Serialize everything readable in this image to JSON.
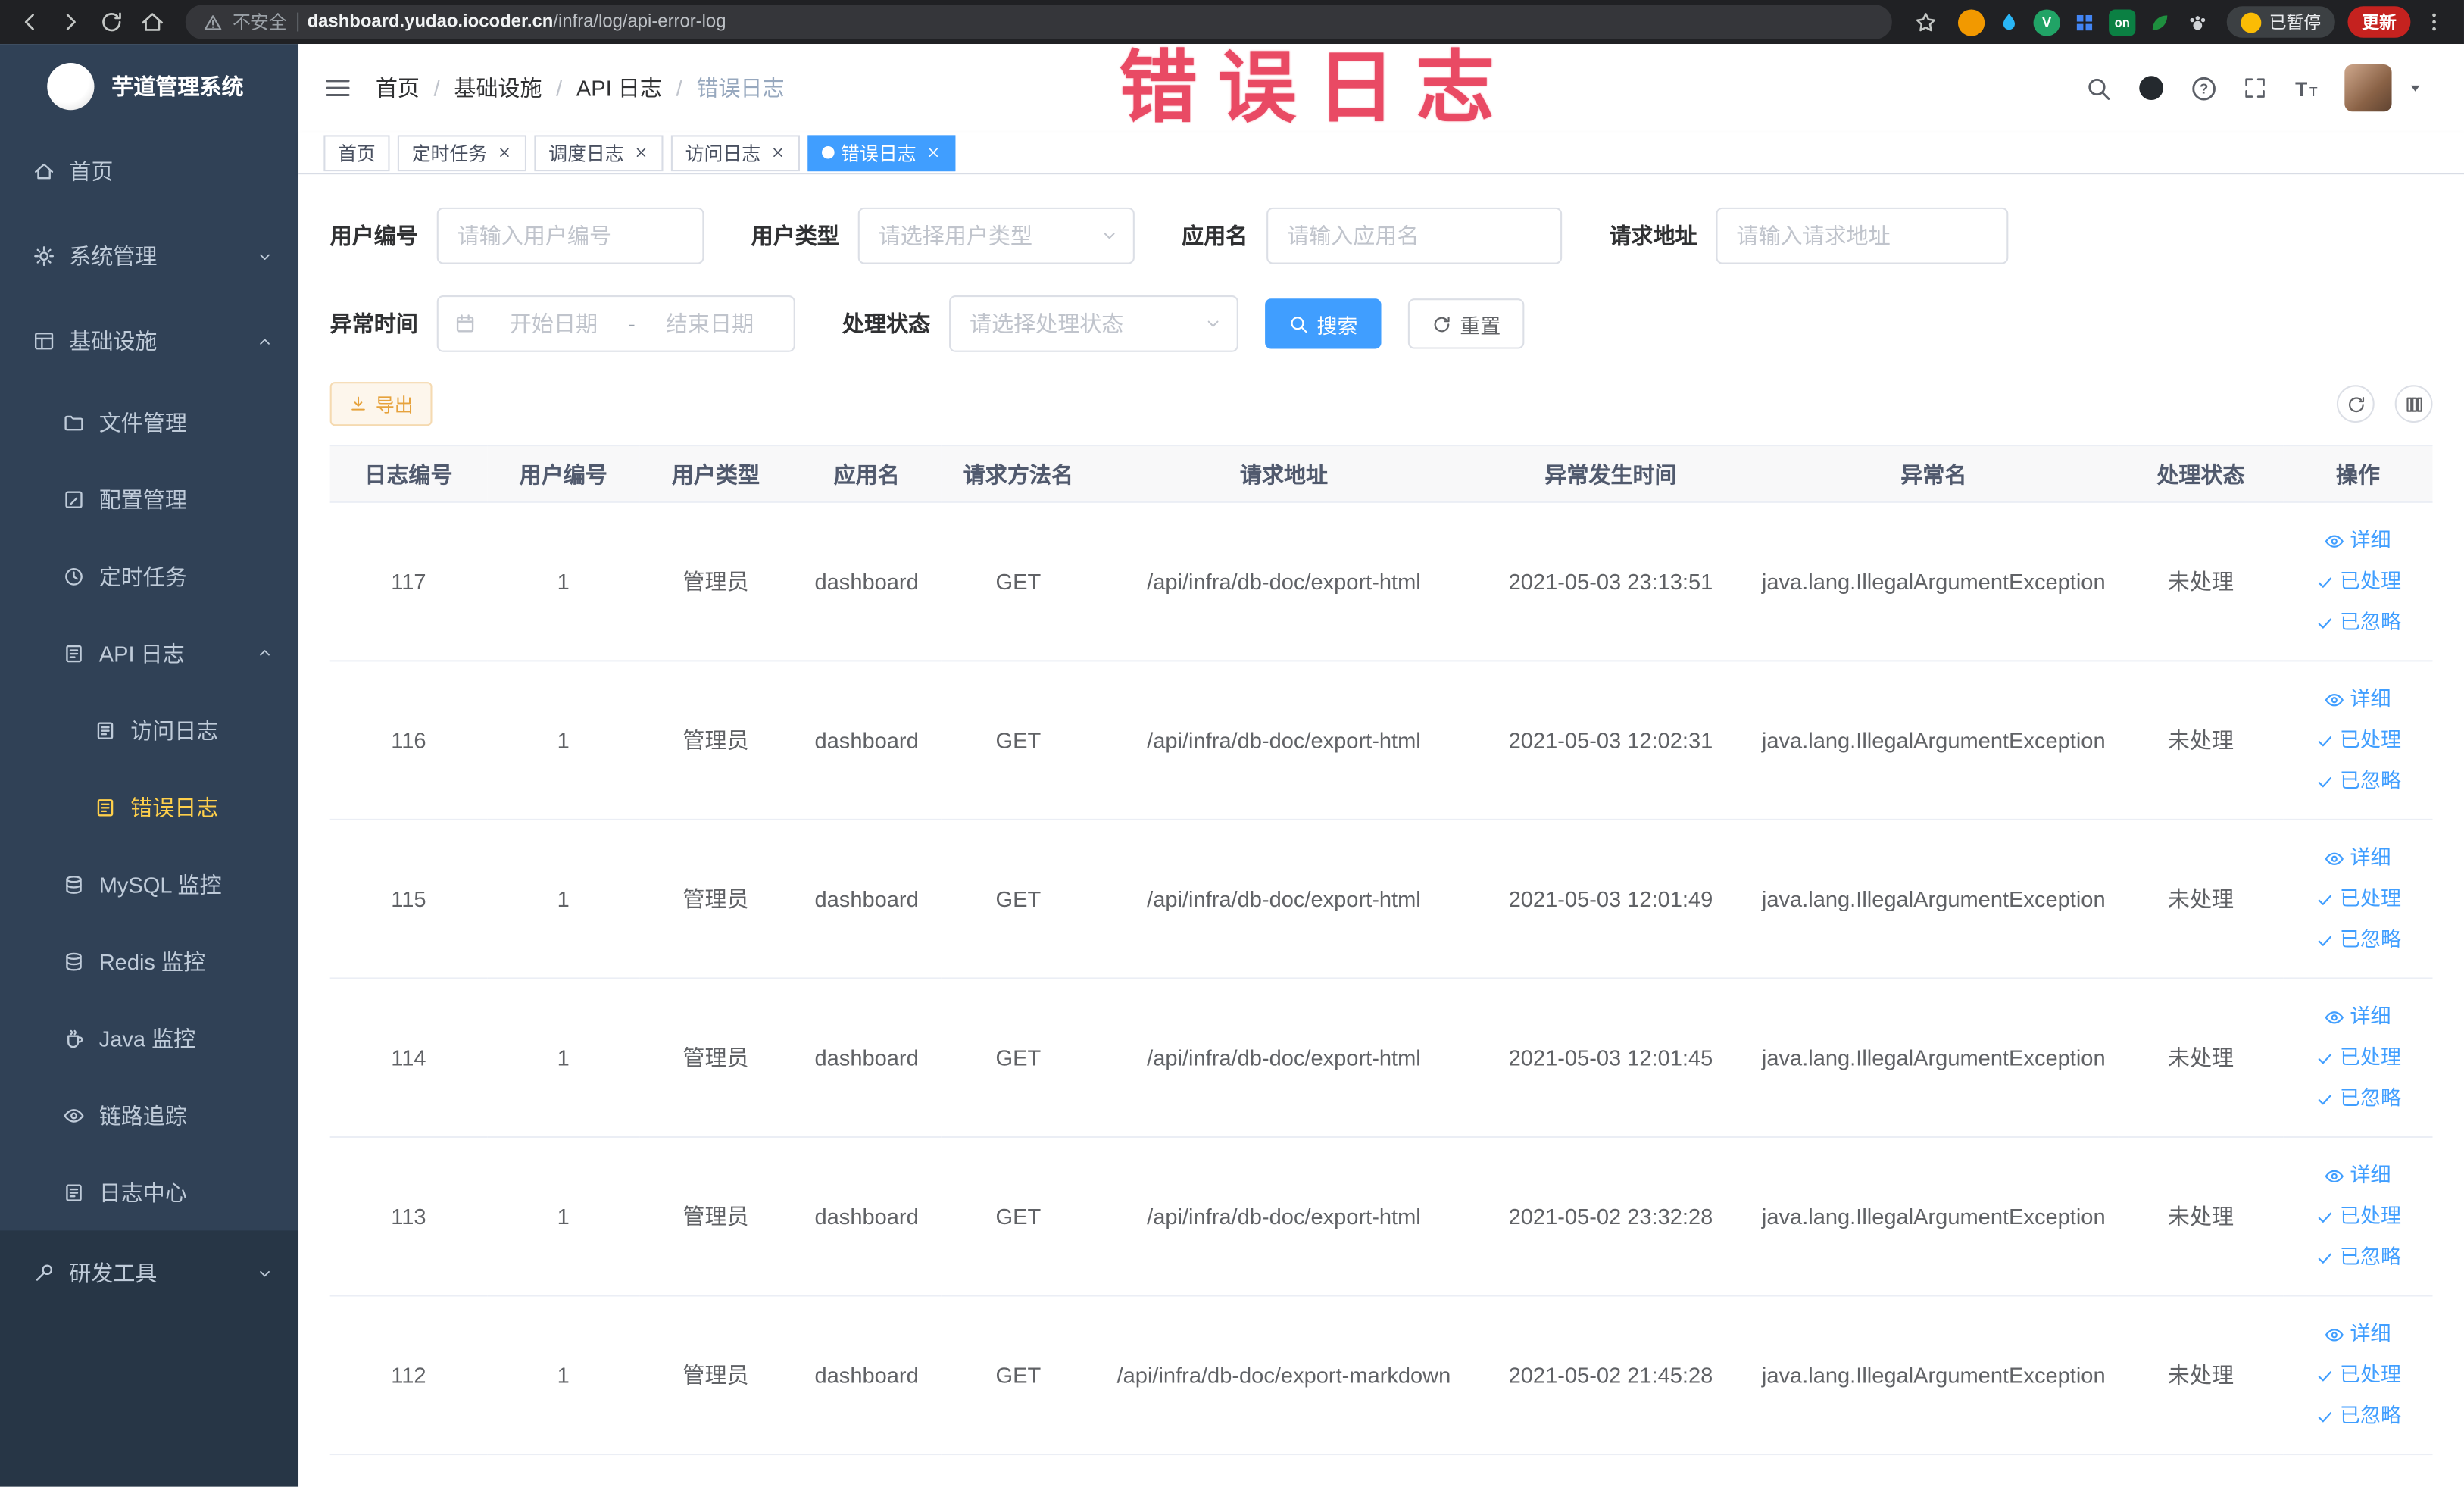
{
  "annotation": {
    "overlay_text": "错误日志"
  },
  "browser": {
    "security_label": "不安全",
    "url_domain": "dashboard.yudao.iocoder.cn",
    "url_path": "/infra/log/api-error-log",
    "paused_chip": "已暂停",
    "update_button": "更新",
    "extensions": [
      {
        "name": "orange-circle",
        "shape": "circle",
        "color": "#f29900"
      },
      {
        "name": "water-drop",
        "icon": "drop",
        "color": "#29b6f6"
      },
      {
        "name": "green-v",
        "shape": "circle",
        "color": "#21a366",
        "label": "V"
      },
      {
        "name": "blue-grid",
        "icon": "gridext",
        "color": "#4285f4"
      },
      {
        "name": "on-badge",
        "shape": "square",
        "color": "#0b8043",
        "label": "on"
      },
      {
        "name": "leaf",
        "icon": "leaf",
        "color": "#1e8e3e"
      },
      {
        "name": "paw",
        "icon": "paw",
        "color": "#cfd2d6"
      }
    ]
  },
  "sidebar": {
    "logo_title": "芋道管理系统",
    "items": [
      {
        "key": "home",
        "label": "首页",
        "icon": "home",
        "level": 1
      },
      {
        "key": "system",
        "label": "系统管理",
        "icon": "gear",
        "level": 1,
        "arrow": "down"
      },
      {
        "key": "infra",
        "label": "基础设施",
        "icon": "grid",
        "level": 1,
        "arrow": "up"
      },
      {
        "key": "file",
        "label": "文件管理",
        "icon": "folder",
        "level": 2
      },
      {
        "key": "config",
        "label": "配置管理",
        "icon": "edit",
        "level": 2
      },
      {
        "key": "job",
        "label": "定时任务",
        "icon": "clock",
        "level": 2
      },
      {
        "key": "api-log",
        "label": "API 日志",
        "icon": "log",
        "level": 2,
        "arrow": "up"
      },
      {
        "key": "access-log",
        "label": "访问日志",
        "icon": "doc",
        "level": 3
      },
      {
        "key": "error-log",
        "label": "错误日志",
        "icon": "doc",
        "level": 3,
        "active": true
      },
      {
        "key": "mysql",
        "label": "MySQL 监控",
        "icon": "db",
        "level": 2
      },
      {
        "key": "redis",
        "label": "Redis 监控",
        "icon": "db",
        "level": 2
      },
      {
        "key": "java",
        "label": "Java 监控",
        "icon": "java",
        "level": 2
      },
      {
        "key": "tracer",
        "label": "链路追踪",
        "icon": "eye",
        "level": 2
      },
      {
        "key": "log-center",
        "label": "日志中心",
        "icon": "log",
        "level": 2
      },
      {
        "key": "dev-tool",
        "label": "研发工具",
        "icon": "tool",
        "level": 1,
        "arrow": "down",
        "section": "bottom"
      }
    ]
  },
  "header": {
    "breadcrumb": [
      "首页",
      "基础设施",
      "API 日志",
      "错误日志"
    ]
  },
  "tabs": [
    {
      "key": "home",
      "label": "首页",
      "closable": false,
      "active": false
    },
    {
      "key": "job",
      "label": "定时任务",
      "closable": true,
      "active": false
    },
    {
      "key": "job-log",
      "label": "调度日志",
      "closable": true,
      "active": false
    },
    {
      "key": "access-log",
      "label": "访问日志",
      "closable": true,
      "active": false
    },
    {
      "key": "error-log",
      "label": "错误日志",
      "closable": true,
      "active": true
    }
  ],
  "filters": {
    "user_id": {
      "label": "用户编号",
      "placeholder": "请输入用户编号"
    },
    "user_type": {
      "label": "用户类型",
      "placeholder": "请选择用户类型"
    },
    "app_name": {
      "label": "应用名",
      "placeholder": "请输入应用名"
    },
    "request_url": {
      "label": "请求地址",
      "placeholder": "请输入请求地址"
    },
    "exception_time": {
      "label": "异常时间",
      "start_placeholder": "开始日期",
      "range_separator": "-",
      "end_placeholder": "结束日期"
    },
    "process_status": {
      "label": "处理状态",
      "placeholder": "请选择处理状态"
    },
    "search_label": "搜索",
    "reset_label": "重置"
  },
  "toolbar": {
    "export_label": "导出"
  },
  "table": {
    "columns": [
      "日志编号",
      "用户编号",
      "用户类型",
      "应用名",
      "请求方法名",
      "请求地址",
      "异常发生时间",
      "异常名",
      "处理状态",
      "操作"
    ],
    "actions": {
      "detail": "详细",
      "processed": "已处理",
      "ignored": "已忽略"
    },
    "rows": [
      {
        "id": "117",
        "user_id": "1",
        "user_type": "管理员",
        "app": "dashboard",
        "method": "GET",
        "url": "/api/infra/db-doc/export-html",
        "time": "2021-05-03 23:13:51",
        "exception": "java.lang.IllegalArgumentException",
        "status": "未处理"
      },
      {
        "id": "116",
        "user_id": "1",
        "user_type": "管理员",
        "app": "dashboard",
        "method": "GET",
        "url": "/api/infra/db-doc/export-html",
        "time": "2021-05-03 12:02:31",
        "exception": "java.lang.IllegalArgumentException",
        "status": "未处理"
      },
      {
        "id": "115",
        "user_id": "1",
        "user_type": "管理员",
        "app": "dashboard",
        "method": "GET",
        "url": "/api/infra/db-doc/export-html",
        "time": "2021-05-03 12:01:49",
        "exception": "java.lang.IllegalArgumentException",
        "status": "未处理"
      },
      {
        "id": "114",
        "user_id": "1",
        "user_type": "管理员",
        "app": "dashboard",
        "method": "GET",
        "url": "/api/infra/db-doc/export-html",
        "time": "2021-05-03 12:01:45",
        "exception": "java.lang.IllegalArgumentException",
        "status": "未处理"
      },
      {
        "id": "113",
        "user_id": "1",
        "user_type": "管理员",
        "app": "dashboard",
        "method": "GET",
        "url": "/api/infra/db-doc/export-html",
        "time": "2021-05-02 23:32:28",
        "exception": "java.lang.IllegalArgumentException",
        "status": "未处理"
      },
      {
        "id": "112",
        "user_id": "1",
        "user_type": "管理员",
        "app": "dashboard",
        "method": "GET",
        "url": "/api/infra/db-doc/export-markdown",
        "time": "2021-05-02 21:45:28",
        "exception": "java.lang.IllegalArgumentException",
        "status": "未处理"
      }
    ]
  }
}
